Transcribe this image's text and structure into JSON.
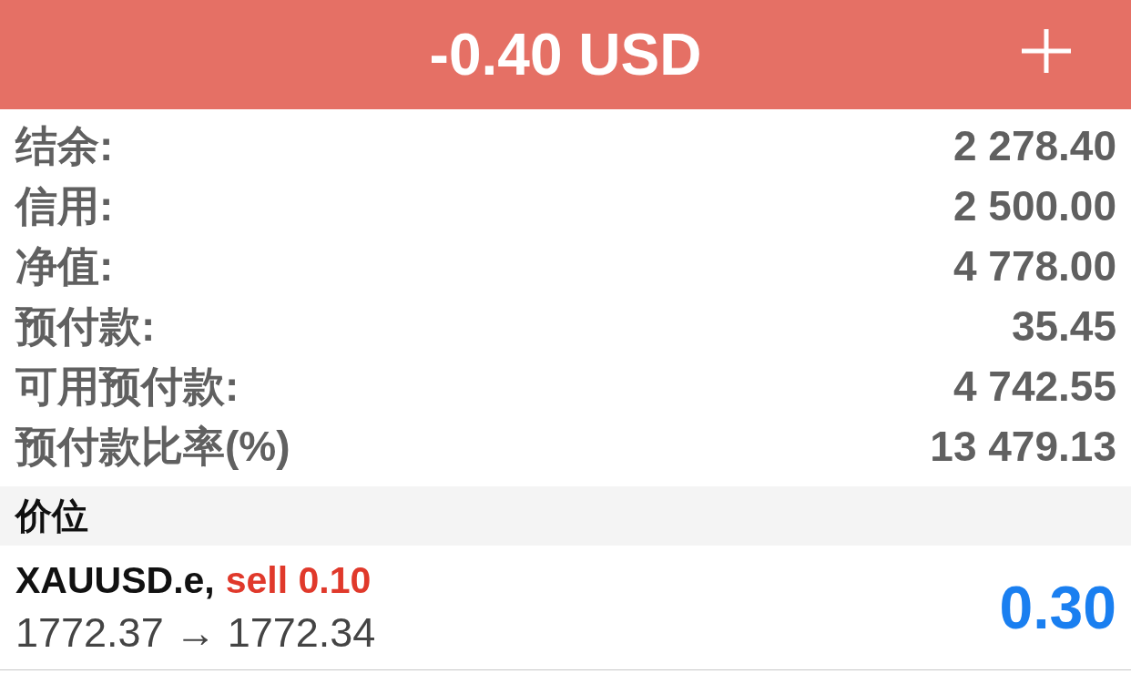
{
  "header": {
    "title": "-0.40 USD"
  },
  "account": [
    {
      "label": "结余:",
      "value": "2 278.40"
    },
    {
      "label": "信用:",
      "value": "2 500.00"
    },
    {
      "label": "净值:",
      "value": "4 778.00"
    },
    {
      "label": "预付款:",
      "value": "35.45"
    },
    {
      "label": "可用预付款:",
      "value": "4 742.55"
    },
    {
      "label": "预付款比率(%)",
      "value": "13 479.13"
    }
  ],
  "section": {
    "title": "价位"
  },
  "positions": [
    {
      "symbol": "XAUUSD.e,",
      "order": "sell 0.10",
      "prices": "1772.37 → 1772.34",
      "profit": "0.30"
    }
  ]
}
